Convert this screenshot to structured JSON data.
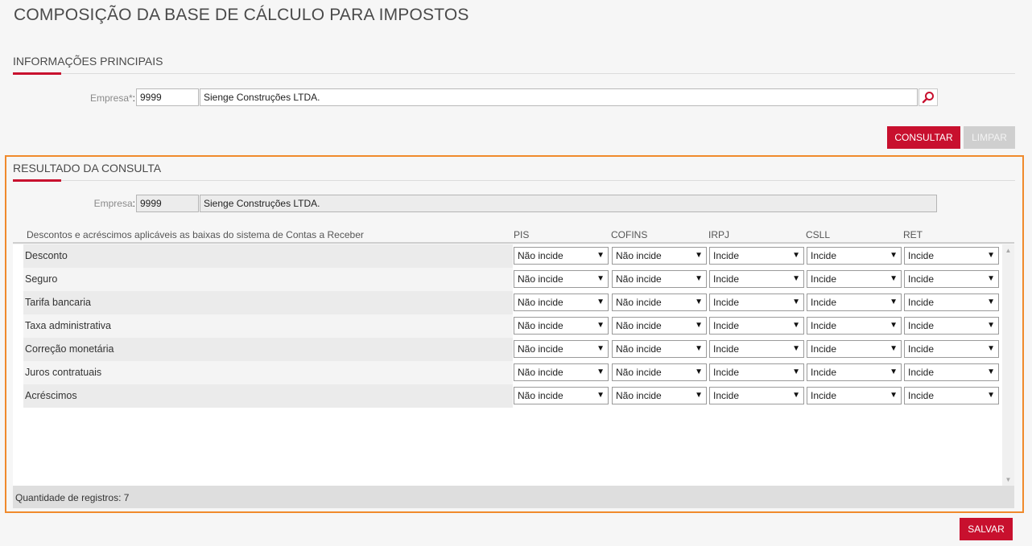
{
  "page": {
    "title": "COMPOSIÇÃO DA BASE DE CÁLCULO PARA IMPOSTOS"
  },
  "main_info": {
    "section_title": "INFORMAÇÕES PRINCIPAIS",
    "empresa_label": "Empresa*",
    "empresa_code": "9999",
    "empresa_name": "Sienge Construções LTDA."
  },
  "actions": {
    "consultar": "CONSULTAR",
    "limpar": "LIMPAR",
    "salvar": "SALVAR"
  },
  "result": {
    "section_title": "RESULTADO DA CONSULTA",
    "empresa_label": "Empresa",
    "empresa_code": "9999",
    "empresa_name": "Sienge Construções LTDA.",
    "columns": {
      "description": "Descontos e acréscimos aplicáveis as baixas do sistema de Contas a Receber",
      "pis": "PIS",
      "cofins": "COFINS",
      "irpj": "IRPJ",
      "csll": "CSLL",
      "ret": "RET"
    },
    "rows": [
      {
        "label": "Desconto",
        "pis": "Não incide",
        "cofins": "Não incide",
        "irpj": "Incide",
        "csll": "Incide",
        "ret": "Incide"
      },
      {
        "label": "Seguro",
        "pis": "Não incide",
        "cofins": "Não incide",
        "irpj": "Incide",
        "csll": "Incide",
        "ret": "Incide"
      },
      {
        "label": "Tarifa bancaria",
        "pis": "Não incide",
        "cofins": "Não incide",
        "irpj": "Incide",
        "csll": "Incide",
        "ret": "Incide"
      },
      {
        "label": "Taxa administrativa",
        "pis": "Não incide",
        "cofins": "Não incide",
        "irpj": "Incide",
        "csll": "Incide",
        "ret": "Incide"
      },
      {
        "label": "Correção monetária",
        "pis": "Não incide",
        "cofins": "Não incide",
        "irpj": "Incide",
        "csll": "Incide",
        "ret": "Incide"
      },
      {
        "label": "Juros contratuais",
        "pis": "Não incide",
        "cofins": "Não incide",
        "irpj": "Incide",
        "csll": "Incide",
        "ret": "Incide"
      },
      {
        "label": "Acréscimos",
        "pis": "Não incide",
        "cofins": "Não incide",
        "irpj": "Incide",
        "csll": "Incide",
        "ret": "Incide"
      }
    ],
    "record_count_label": "Quantidade de registros:",
    "record_count": "7"
  },
  "colors": {
    "accent": "#c8102e",
    "highlight_frame": "#f08a2c",
    "disabled_button": "#cfcfcf"
  },
  "icons": {
    "search": "magnifier-icon",
    "dropdown": "triangle-down-icon",
    "scroll_up": "triangle-up-icon",
    "scroll_down": "triangle-down-icon"
  }
}
